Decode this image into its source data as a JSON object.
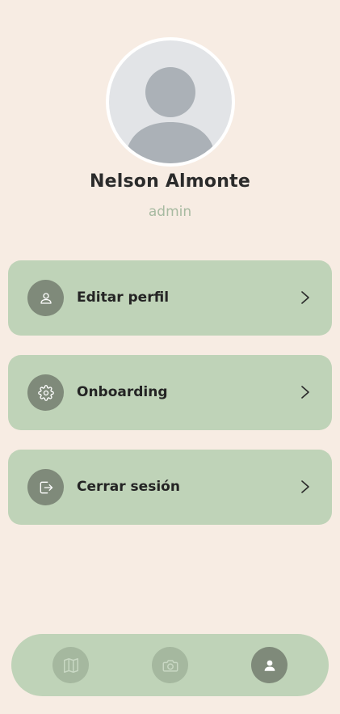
{
  "profile": {
    "name": "Nelson Almonte",
    "role": "admin"
  },
  "menu": {
    "items": [
      {
        "label": "Editar perfil",
        "icon": "user-icon"
      },
      {
        "label": "Onboarding",
        "icon": "gear-icon"
      },
      {
        "label": "Cerrar sesión",
        "icon": "logout-icon"
      }
    ]
  },
  "bottom_nav": {
    "items": [
      {
        "icon": "map-icon",
        "active": false
      },
      {
        "icon": "camera-icon",
        "active": false
      },
      {
        "icon": "user-icon",
        "active": true
      }
    ]
  },
  "colors": {
    "background": "#f7ece3",
    "card": "#bfd3b8",
    "icon_circle": "#7f8a7a",
    "nav_inactive": "#a5b89f",
    "role_text": "#a7baa1"
  }
}
